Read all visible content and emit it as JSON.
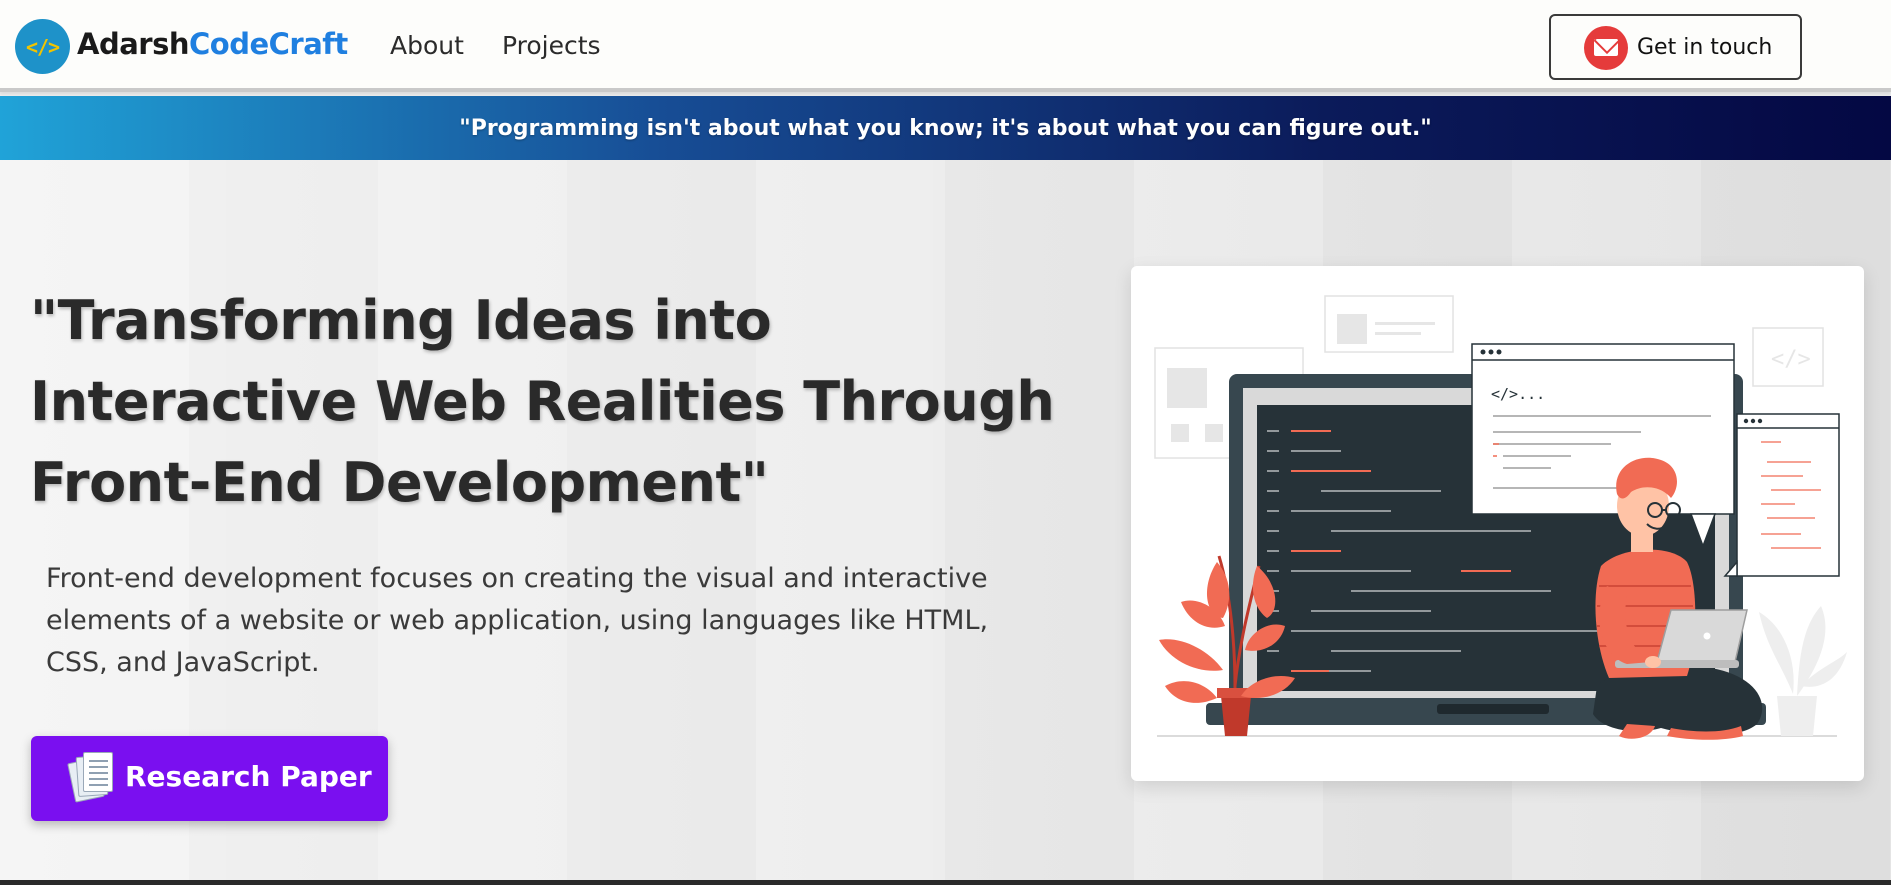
{
  "navbar": {
    "logo_glyph": "</>",
    "brand_part1": "Adarsh",
    "brand_part2": "CodeCraft",
    "links": [
      {
        "label": "About"
      },
      {
        "label": "Projects"
      }
    ],
    "cta_label": "Get in touch",
    "cta_icon": "envelope-icon"
  },
  "banner": {
    "quote": "\"Programming isn't about what you know; it's about what you can figure out.\""
  },
  "hero": {
    "headline": "\"Transforming Ideas into Interactive Web Realities Through Front-End Development\"",
    "description": "Front-end development focuses on creating the visual and interactive elements of a website or web application, using languages like HTML, CSS, and JavaScript.",
    "button_label": "Research Paper",
    "button_icon": "document-stack-icon",
    "illustration": {
      "icon": "developer-with-laptop-illustration",
      "code_tag": "</>..."
    }
  },
  "colors": {
    "brand_blue": "#1f7fe0",
    "logo_bg": "#1e92c9",
    "logo_glyph": "#f2c400",
    "cta_icon_bg": "#e53b3b",
    "button_purple": "#7a0ff0",
    "banner_start": "#20a3d8",
    "banner_end": "#040843",
    "illus_dark": "#263238",
    "illus_accent": "#f16b54"
  }
}
